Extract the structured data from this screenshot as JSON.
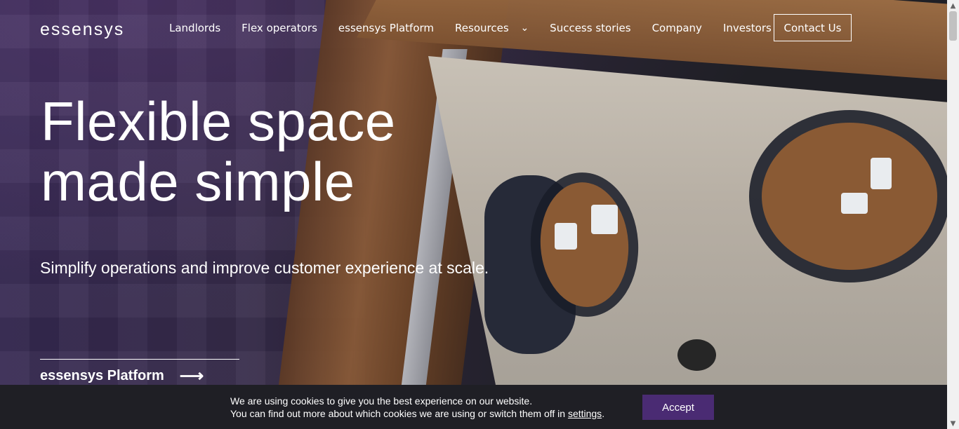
{
  "brand": {
    "logo_text": "essensys"
  },
  "nav": {
    "items": [
      {
        "label": "Landlords"
      },
      {
        "label": "Flex operators"
      },
      {
        "label": "essensys Platform"
      },
      {
        "label": "Resources"
      },
      {
        "label": "Success stories"
      },
      {
        "label": "Company"
      },
      {
        "label": "Investors"
      }
    ],
    "contact_label": "Contact Us"
  },
  "hero": {
    "headline_line1": "Flexible space",
    "headline_line2": "made simple",
    "subhead": "Simplify operations and improve customer experience at scale.",
    "cta_label": "essensys Platform"
  },
  "cookie_banner": {
    "line1": "We are using cookies to give you the best experience on our website.",
    "line2_before": "You can find out more about which cookies we are using or switch them off in",
    "settings_link": "settings",
    "line2_after": ".",
    "accept_label": "Accept"
  },
  "icons": {
    "chevron": "chevron-down-icon",
    "arrow": "arrow-right-icon"
  }
}
